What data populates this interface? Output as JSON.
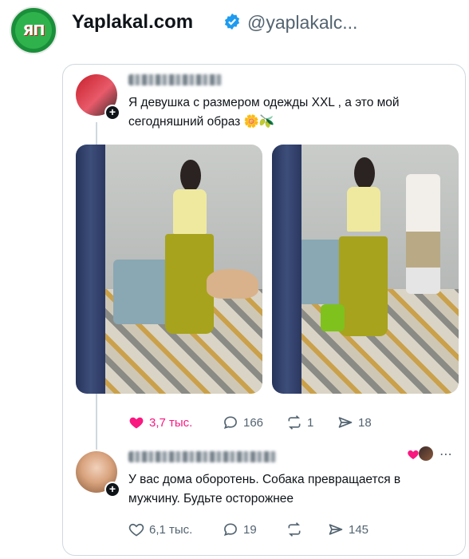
{
  "outer": {
    "logo_text": "ЯП",
    "account_name": "Yaplakal.com",
    "handle": "@yaplakalc..."
  },
  "post": {
    "text": "Я девушка с размером одежды XXL , а это мой сегодняшний образ 🌼🫒",
    "likes": "3,7 тыс.",
    "replies": "166",
    "reposts": "1",
    "shares": "18"
  },
  "reply": {
    "text": "У вас дома оборотень. Собака превращается в мужчину. Будьте осторожнее",
    "likes": "6,1 тыс.",
    "replies": "19",
    "shares": "145"
  },
  "colors": {
    "like_active": "#f91880",
    "verified": "#1d9bf0",
    "muted": "#536471"
  }
}
